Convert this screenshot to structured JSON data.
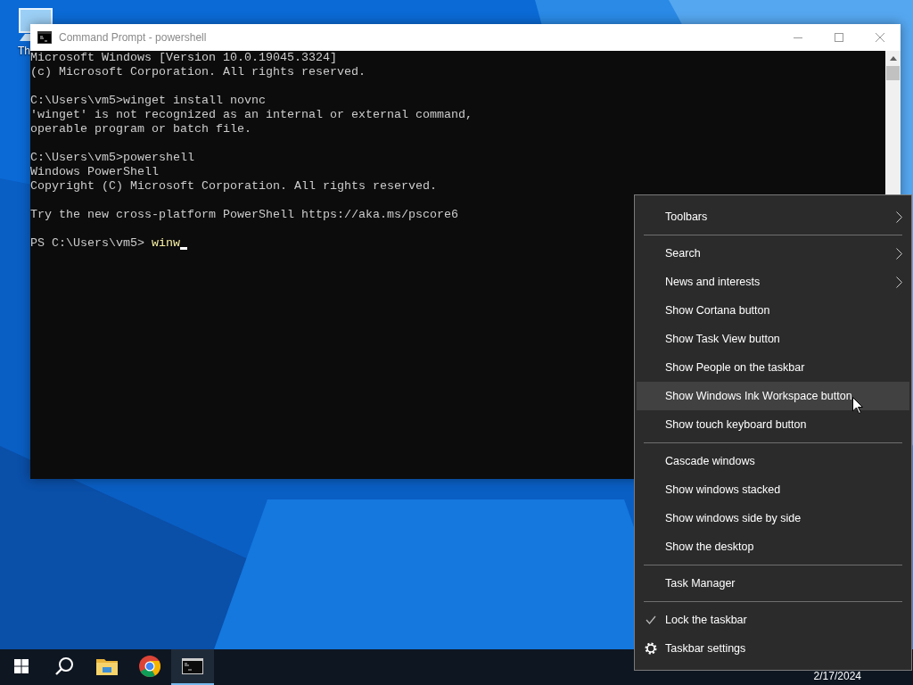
{
  "desktop": {
    "icons": [
      {
        "label": "Th"
      }
    ]
  },
  "window": {
    "title": "Command Prompt - powershell",
    "console": {
      "blocks": [
        [
          "Microsoft Windows [Version 10.0.19045.3324]",
          "(c) Microsoft Corporation. All rights reserved."
        ],
        [
          "C:\\Users\\vm5>winget install novnc",
          "'winget' is not recognized as an internal or external command,",
          "operable program or batch file."
        ],
        [
          "C:\\Users\\vm5>powershell",
          "Windows PowerShell",
          "Copyright (C) Microsoft Corporation. All rights reserved."
        ],
        [
          "Try the new cross-platform PowerShell https://aka.ms/pscore6"
        ]
      ],
      "prompt": "PS C:\\Users\\vm5>",
      "input": "winw"
    }
  },
  "context_menu": {
    "groups": [
      {
        "items": [
          {
            "label": "Toolbars",
            "kind": "submenu",
            "selected": false
          }
        ]
      },
      {
        "items": [
          {
            "label": "Search",
            "kind": "submenu",
            "selected": false
          },
          {
            "label": "News and interests",
            "kind": "submenu",
            "selected": false
          },
          {
            "label": "Show Cortana button",
            "kind": "command",
            "selected": false
          },
          {
            "label": "Show Task View button",
            "kind": "command",
            "selected": false
          },
          {
            "label": "Show People on the taskbar",
            "kind": "command",
            "selected": false
          },
          {
            "label": "Show Windows Ink Workspace button",
            "kind": "command",
            "selected": true
          },
          {
            "label": "Show touch keyboard button",
            "kind": "command",
            "selected": false
          }
        ]
      },
      {
        "items": [
          {
            "label": "Cascade windows",
            "kind": "command",
            "selected": false
          },
          {
            "label": "Show windows stacked",
            "kind": "command",
            "selected": false
          },
          {
            "label": "Show windows side by side",
            "kind": "command",
            "selected": false
          },
          {
            "label": "Show the desktop",
            "kind": "command",
            "selected": false
          }
        ]
      },
      {
        "items": [
          {
            "label": "Task Manager",
            "kind": "command",
            "selected": false
          }
        ]
      },
      {
        "items": [
          {
            "label": "Lock the taskbar",
            "kind": "check",
            "checked": true,
            "selected": false
          },
          {
            "label": "Taskbar settings",
            "kind": "settings",
            "selected": false
          }
        ]
      }
    ]
  },
  "taskbar": {
    "apps": [
      {
        "kind": "start",
        "selected": false
      },
      {
        "kind": "search",
        "selected": false
      },
      {
        "kind": "folder",
        "selected": false
      },
      {
        "kind": "browser",
        "selected": false
      },
      {
        "kind": "terminal",
        "selected": true
      }
    ],
    "date": "2/17/2024"
  }
}
